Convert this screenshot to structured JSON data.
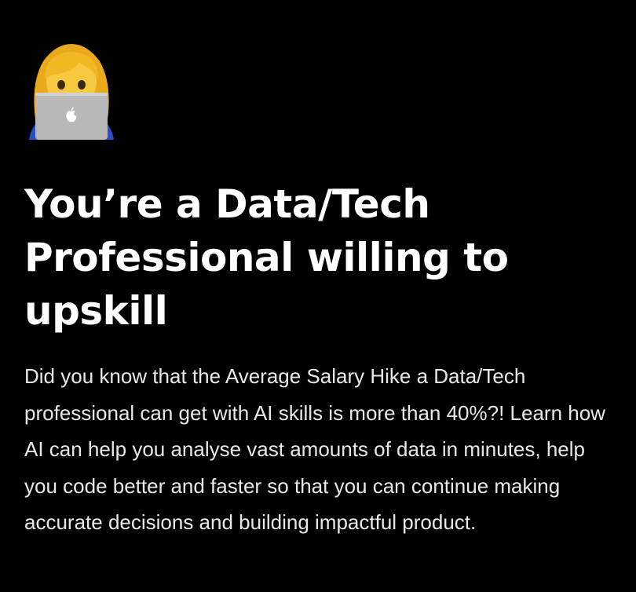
{
  "hero": {
    "icon": "woman-technologist-emoji",
    "heading": "You’re a Data/Tech Professional willing to upskill",
    "body": "Did you know that the Average Salary Hike a Data/Tech professional can get with AI skills is more than 40%?! Learn how AI can help you analyse vast amounts of data in minutes, help you code better and faster so that you can continue making accurate decisions and building impactful product."
  },
  "colors": {
    "background": "#000000",
    "heading": "#ffffff",
    "body": "#e8e8e8",
    "laptop": "#b8b8b8",
    "hair": "#f2b824",
    "skin": "#f7c840",
    "shirt": "#2b4fc2"
  }
}
